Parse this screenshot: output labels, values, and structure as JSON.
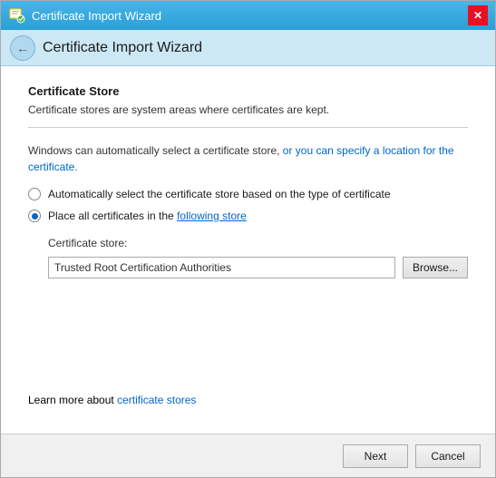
{
  "window": {
    "title": "Certificate Import Wizard",
    "close_label": "✕"
  },
  "nav": {
    "back_icon": "←"
  },
  "section": {
    "title": "Certificate Store",
    "description": "Certificate stores are system areas where certificates are kept."
  },
  "info": {
    "text_part1": "Windows can automatically select a certificate store, or you can specify a location for the certificate."
  },
  "radio1": {
    "label": "Automatically select the certificate store based on the type of certificate"
  },
  "radio2": {
    "label_prefix": "Place all certificates in the ",
    "label_link": "following store",
    "label": "Place all certificates in the following store"
  },
  "cert_store": {
    "label": "Certificate store:",
    "value": "Trusted Root Certification Authorities",
    "browse_label": "Browse..."
  },
  "learn_more": {
    "prefix": "Learn more about ",
    "link_text": "certificate stores"
  },
  "footer": {
    "next_label": "Next",
    "cancel_label": "Cancel"
  }
}
